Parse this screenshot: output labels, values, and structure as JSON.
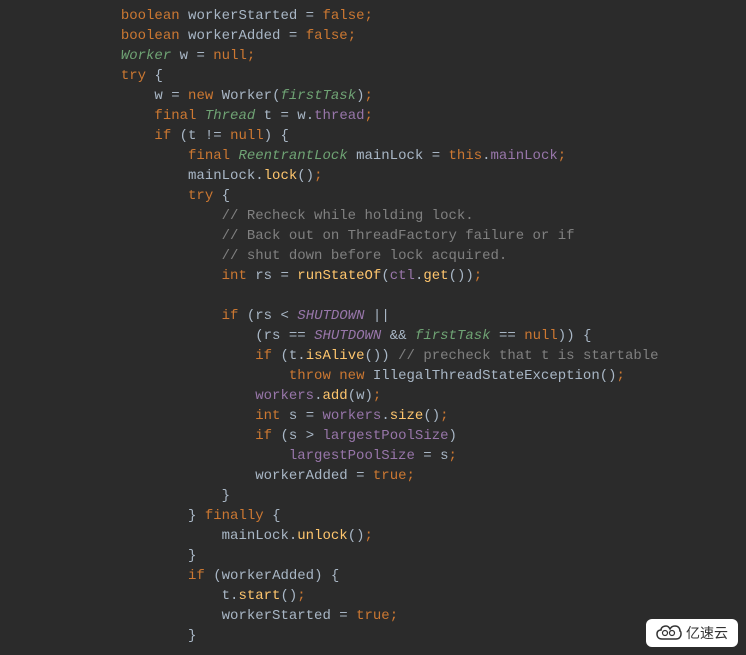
{
  "code": {
    "lines": [
      {
        "indent": 3,
        "tokens": [
          {
            "t": "kw",
            "v": "boolean"
          },
          {
            "t": "sp",
            "v": " "
          },
          {
            "t": "ident",
            "v": "workerStarted"
          },
          {
            "t": "sp",
            "v": " "
          },
          {
            "t": "op",
            "v": "="
          },
          {
            "t": "sp",
            "v": " "
          },
          {
            "t": "bool",
            "v": "false"
          },
          {
            "t": "semi",
            "v": ";"
          }
        ]
      },
      {
        "indent": 3,
        "tokens": [
          {
            "t": "kw",
            "v": "boolean"
          },
          {
            "t": "sp",
            "v": " "
          },
          {
            "t": "ident",
            "v": "workerAdded"
          },
          {
            "t": "sp",
            "v": " "
          },
          {
            "t": "op",
            "v": "="
          },
          {
            "t": "sp",
            "v": " "
          },
          {
            "t": "bool",
            "v": "false"
          },
          {
            "t": "semi",
            "v": ";"
          }
        ]
      },
      {
        "indent": 3,
        "tokens": [
          {
            "t": "type-green",
            "v": "Worker"
          },
          {
            "t": "sp",
            "v": " "
          },
          {
            "t": "ident",
            "v": "w"
          },
          {
            "t": "sp",
            "v": " "
          },
          {
            "t": "op",
            "v": "="
          },
          {
            "t": "sp",
            "v": " "
          },
          {
            "t": "null-kw",
            "v": "null"
          },
          {
            "t": "semi",
            "v": ";"
          }
        ]
      },
      {
        "indent": 3,
        "tokens": [
          {
            "t": "try-kw",
            "v": "try"
          },
          {
            "t": "sp",
            "v": " "
          },
          {
            "t": "punc",
            "v": "{"
          }
        ]
      },
      {
        "indent": 4,
        "tokens": [
          {
            "t": "ident",
            "v": "w"
          },
          {
            "t": "sp",
            "v": " "
          },
          {
            "t": "op",
            "v": "="
          },
          {
            "t": "sp",
            "v": " "
          },
          {
            "t": "new-kw",
            "v": "new"
          },
          {
            "t": "sp",
            "v": " "
          },
          {
            "t": "ident",
            "v": "Worker("
          },
          {
            "t": "param",
            "v": "firstTask"
          },
          {
            "t": "punc",
            "v": ")"
          },
          {
            "t": "semi",
            "v": ";"
          }
        ]
      },
      {
        "indent": 4,
        "tokens": [
          {
            "t": "final-kw",
            "v": "final"
          },
          {
            "t": "sp",
            "v": " "
          },
          {
            "t": "type-green",
            "v": "Thread"
          },
          {
            "t": "sp",
            "v": " "
          },
          {
            "t": "ident",
            "v": "t"
          },
          {
            "t": "sp",
            "v": " "
          },
          {
            "t": "op",
            "v": "="
          },
          {
            "t": "sp",
            "v": " "
          },
          {
            "t": "ident",
            "v": "w"
          },
          {
            "t": "punc",
            "v": "."
          },
          {
            "t": "field",
            "v": "thread"
          },
          {
            "t": "semi",
            "v": ";"
          }
        ]
      },
      {
        "indent": 4,
        "tokens": [
          {
            "t": "if-kw",
            "v": "if"
          },
          {
            "t": "sp",
            "v": " "
          },
          {
            "t": "punc",
            "v": "("
          },
          {
            "t": "ident",
            "v": "t"
          },
          {
            "t": "sp",
            "v": " "
          },
          {
            "t": "op",
            "v": "!="
          },
          {
            "t": "sp",
            "v": " "
          },
          {
            "t": "null-kw",
            "v": "null"
          },
          {
            "t": "punc",
            "v": ")"
          },
          {
            "t": "sp",
            "v": " "
          },
          {
            "t": "punc",
            "v": "{"
          }
        ]
      },
      {
        "indent": 5,
        "tokens": [
          {
            "t": "final-kw",
            "v": "final"
          },
          {
            "t": "sp",
            "v": " "
          },
          {
            "t": "type-green",
            "v": "ReentrantLock"
          },
          {
            "t": "sp",
            "v": " "
          },
          {
            "t": "ident",
            "v": "mainLock"
          },
          {
            "t": "sp",
            "v": " "
          },
          {
            "t": "op",
            "v": "="
          },
          {
            "t": "sp",
            "v": " "
          },
          {
            "t": "this-kw",
            "v": "this"
          },
          {
            "t": "punc",
            "v": "."
          },
          {
            "t": "field",
            "v": "mainLock"
          },
          {
            "t": "semi",
            "v": ";"
          }
        ]
      },
      {
        "indent": 5,
        "tokens": [
          {
            "t": "ident",
            "v": "mainLock"
          },
          {
            "t": "punc",
            "v": "."
          },
          {
            "t": "method",
            "v": "lock"
          },
          {
            "t": "punc",
            "v": "()"
          },
          {
            "t": "semi",
            "v": ";"
          }
        ]
      },
      {
        "indent": 5,
        "tokens": [
          {
            "t": "try-kw",
            "v": "try"
          },
          {
            "t": "sp",
            "v": " "
          },
          {
            "t": "punc",
            "v": "{"
          }
        ]
      },
      {
        "indent": 6,
        "tokens": [
          {
            "t": "comment",
            "v": "// Recheck while holding lock."
          }
        ]
      },
      {
        "indent": 6,
        "tokens": [
          {
            "t": "comment",
            "v": "// Back out on ThreadFactory failure or if"
          }
        ]
      },
      {
        "indent": 6,
        "tokens": [
          {
            "t": "comment",
            "v": "// shut down before lock acquired."
          }
        ]
      },
      {
        "indent": 6,
        "tokens": [
          {
            "t": "int-kw",
            "v": "int"
          },
          {
            "t": "sp",
            "v": " "
          },
          {
            "t": "ident",
            "v": "rs"
          },
          {
            "t": "sp",
            "v": " "
          },
          {
            "t": "op",
            "v": "="
          },
          {
            "t": "sp",
            "v": " "
          },
          {
            "t": "method",
            "v": "runStateOf"
          },
          {
            "t": "punc",
            "v": "("
          },
          {
            "t": "field",
            "v": "ctl"
          },
          {
            "t": "punc",
            "v": "."
          },
          {
            "t": "method",
            "v": "get"
          },
          {
            "t": "punc",
            "v": "())"
          },
          {
            "t": "semi",
            "v": ";"
          }
        ]
      },
      {
        "indent": 0,
        "tokens": []
      },
      {
        "indent": 6,
        "tokens": [
          {
            "t": "if-kw",
            "v": "if"
          },
          {
            "t": "sp",
            "v": " "
          },
          {
            "t": "punc",
            "v": "("
          },
          {
            "t": "ident",
            "v": "rs"
          },
          {
            "t": "sp",
            "v": " "
          },
          {
            "t": "op",
            "v": "<"
          },
          {
            "t": "sp",
            "v": " "
          },
          {
            "t": "constant",
            "v": "SHUTDOWN"
          },
          {
            "t": "sp",
            "v": " "
          },
          {
            "t": "op",
            "v": "||"
          }
        ]
      },
      {
        "indent": 7,
        "tokens": [
          {
            "t": "punc",
            "v": "("
          },
          {
            "t": "ident",
            "v": "rs"
          },
          {
            "t": "sp",
            "v": " "
          },
          {
            "t": "op",
            "v": "=="
          },
          {
            "t": "sp",
            "v": " "
          },
          {
            "t": "constant",
            "v": "SHUTDOWN"
          },
          {
            "t": "sp",
            "v": " "
          },
          {
            "t": "op",
            "v": "&&"
          },
          {
            "t": "sp",
            "v": " "
          },
          {
            "t": "param",
            "v": "firstTask"
          },
          {
            "t": "sp",
            "v": " "
          },
          {
            "t": "op",
            "v": "=="
          },
          {
            "t": "sp",
            "v": " "
          },
          {
            "t": "null-kw",
            "v": "null"
          },
          {
            "t": "punc",
            "v": "))"
          },
          {
            "t": "sp",
            "v": " "
          },
          {
            "t": "punc",
            "v": "{"
          }
        ]
      },
      {
        "indent": 7,
        "tokens": [
          {
            "t": "if-kw",
            "v": "if"
          },
          {
            "t": "sp",
            "v": " "
          },
          {
            "t": "punc",
            "v": "("
          },
          {
            "t": "ident",
            "v": "t"
          },
          {
            "t": "punc",
            "v": "."
          },
          {
            "t": "method",
            "v": "isAlive"
          },
          {
            "t": "punc",
            "v": "())"
          },
          {
            "t": "sp",
            "v": " "
          },
          {
            "t": "comment",
            "v": "// precheck that t is startable"
          }
        ]
      },
      {
        "indent": 8,
        "tokens": [
          {
            "t": "throw-kw",
            "v": "throw"
          },
          {
            "t": "sp",
            "v": " "
          },
          {
            "t": "new-kw",
            "v": "new"
          },
          {
            "t": "sp",
            "v": " "
          },
          {
            "t": "ident",
            "v": "IllegalThreadStateException()"
          },
          {
            "t": "semi",
            "v": ";"
          }
        ]
      },
      {
        "indent": 7,
        "tokens": [
          {
            "t": "field",
            "v": "workers"
          },
          {
            "t": "punc",
            "v": "."
          },
          {
            "t": "method",
            "v": "add"
          },
          {
            "t": "punc",
            "v": "("
          },
          {
            "t": "ident",
            "v": "w"
          },
          {
            "t": "punc",
            "v": ")"
          },
          {
            "t": "semi",
            "v": ";"
          }
        ]
      },
      {
        "indent": 7,
        "tokens": [
          {
            "t": "int-kw",
            "v": "int"
          },
          {
            "t": "sp",
            "v": " "
          },
          {
            "t": "ident",
            "v": "s"
          },
          {
            "t": "sp",
            "v": " "
          },
          {
            "t": "op",
            "v": "="
          },
          {
            "t": "sp",
            "v": " "
          },
          {
            "t": "field",
            "v": "workers"
          },
          {
            "t": "punc",
            "v": "."
          },
          {
            "t": "method",
            "v": "size"
          },
          {
            "t": "punc",
            "v": "()"
          },
          {
            "t": "semi",
            "v": ";"
          }
        ]
      },
      {
        "indent": 7,
        "tokens": [
          {
            "t": "if-kw",
            "v": "if"
          },
          {
            "t": "sp",
            "v": " "
          },
          {
            "t": "punc",
            "v": "("
          },
          {
            "t": "ident",
            "v": "s"
          },
          {
            "t": "sp",
            "v": " "
          },
          {
            "t": "op",
            "v": ">"
          },
          {
            "t": "sp",
            "v": " "
          },
          {
            "t": "field",
            "v": "largestPoolSize"
          },
          {
            "t": "punc",
            "v": ")"
          }
        ]
      },
      {
        "indent": 8,
        "tokens": [
          {
            "t": "field",
            "v": "largestPoolSize"
          },
          {
            "t": "sp",
            "v": " "
          },
          {
            "t": "op",
            "v": "="
          },
          {
            "t": "sp",
            "v": " "
          },
          {
            "t": "ident",
            "v": "s"
          },
          {
            "t": "semi",
            "v": ";"
          }
        ]
      },
      {
        "indent": 7,
        "tokens": [
          {
            "t": "ident",
            "v": "workerAdded"
          },
          {
            "t": "sp",
            "v": " "
          },
          {
            "t": "op",
            "v": "="
          },
          {
            "t": "sp",
            "v": " "
          },
          {
            "t": "bool",
            "v": "true"
          },
          {
            "t": "semi",
            "v": ";"
          }
        ]
      },
      {
        "indent": 6,
        "tokens": [
          {
            "t": "punc",
            "v": "}"
          }
        ]
      },
      {
        "indent": 5,
        "tokens": [
          {
            "t": "punc",
            "v": "}"
          },
          {
            "t": "sp",
            "v": " "
          },
          {
            "t": "kw",
            "v": "finally"
          },
          {
            "t": "sp",
            "v": " "
          },
          {
            "t": "punc",
            "v": "{"
          }
        ]
      },
      {
        "indent": 6,
        "tokens": [
          {
            "t": "ident",
            "v": "mainLock"
          },
          {
            "t": "punc",
            "v": "."
          },
          {
            "t": "method",
            "v": "unlock"
          },
          {
            "t": "punc",
            "v": "()"
          },
          {
            "t": "semi",
            "v": ";"
          }
        ]
      },
      {
        "indent": 5,
        "tokens": [
          {
            "t": "punc",
            "v": "}"
          }
        ]
      },
      {
        "indent": 5,
        "tokens": [
          {
            "t": "if-kw",
            "v": "if"
          },
          {
            "t": "sp",
            "v": " "
          },
          {
            "t": "punc",
            "v": "("
          },
          {
            "t": "ident",
            "v": "workerAdded"
          },
          {
            "t": "punc",
            "v": ")"
          },
          {
            "t": "sp",
            "v": " "
          },
          {
            "t": "punc",
            "v": "{"
          }
        ]
      },
      {
        "indent": 6,
        "tokens": [
          {
            "t": "ident",
            "v": "t"
          },
          {
            "t": "punc",
            "v": "."
          },
          {
            "t": "method",
            "v": "start"
          },
          {
            "t": "punc",
            "v": "()"
          },
          {
            "t": "semi",
            "v": ";"
          }
        ]
      },
      {
        "indent": 6,
        "tokens": [
          {
            "t": "ident",
            "v": "workerStarted"
          },
          {
            "t": "sp",
            "v": " "
          },
          {
            "t": "op",
            "v": "="
          },
          {
            "t": "sp",
            "v": " "
          },
          {
            "t": "bool",
            "v": "true"
          },
          {
            "t": "semi",
            "v": ";"
          }
        ]
      },
      {
        "indent": 5,
        "tokens": [
          {
            "t": "punc",
            "v": "}"
          }
        ]
      }
    ]
  },
  "watermark": {
    "text": "亿速云"
  }
}
